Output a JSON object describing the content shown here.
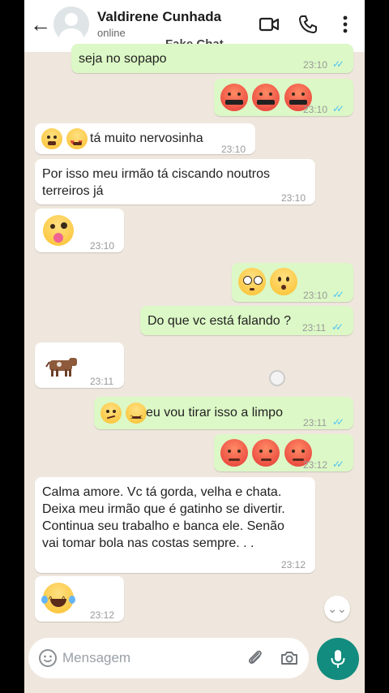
{
  "header": {
    "back_icon": "arrow-left-icon",
    "contact_name": "Valdirene Cunhada",
    "status": "online",
    "watermark": "Fake Chat",
    "icons": [
      "video-call-icon",
      "phone-icon",
      "more-vert-icon"
    ]
  },
  "messages": [
    {
      "dir": "out",
      "text": "seja no sopapo",
      "time": "23:10",
      "read": true
    },
    {
      "dir": "out",
      "emojis": [
        "angry-cursing-face",
        "angry-cursing-face",
        "angry-cursing-face"
      ],
      "time": "23:10",
      "read": true
    },
    {
      "dir": "in",
      "emojis": [
        "tears-of-joy-face",
        "heart-eyes-face"
      ],
      "text": "tá muito nervosinha",
      "time": "23:10"
    },
    {
      "dir": "in",
      "text": "Por isso meu irmão tá ciscando noutros\nterreiros já",
      "time": "23:10"
    },
    {
      "dir": "in",
      "emojis": [
        "zany-tongue-face"
      ],
      "time": "23:10"
    },
    {
      "dir": "out",
      "emojis": [
        "flushed-face",
        "hushed-face"
      ],
      "time": "23:10",
      "read": true
    },
    {
      "dir": "out",
      "text": "Do que vc está falando ?",
      "time": "23:11",
      "read": true
    },
    {
      "dir": "in",
      "emojis": [
        "cow-emoji"
      ],
      "time": "23:11"
    },
    {
      "dir": "out",
      "emojis": [
        "confused-face",
        "persevering-face"
      ],
      "text": "eu vou tirar isso a limpo",
      "time": "23:11",
      "read": true
    },
    {
      "dir": "out",
      "emojis": [
        "angry-face",
        "angry-face",
        "angry-face"
      ],
      "time": "23:12",
      "read": true
    },
    {
      "dir": "in",
      "text": "Calma amore. Vc tá gorda, velha e chata.\nDeixa meu irmão que é gatinho se divertir.\nContinua seu trabalho e banca ele. Senão\nvai tomar bola nas costas sempre. . .",
      "time": "23:12"
    },
    {
      "dir": "in",
      "emojis": [
        "tears-of-joy-face"
      ],
      "time": "23:12"
    }
  ],
  "composer": {
    "placeholder": "Mensagem",
    "icons": [
      "emoji-icon",
      "attach-icon",
      "camera-icon",
      "mic-icon"
    ]
  },
  "colors": {
    "incoming": "#ffffff",
    "outgoing": "#dcf8c6",
    "read_ticks": "#4fc3f7",
    "accent": "#128c7e",
    "wallpaper": "#efe7dd"
  }
}
